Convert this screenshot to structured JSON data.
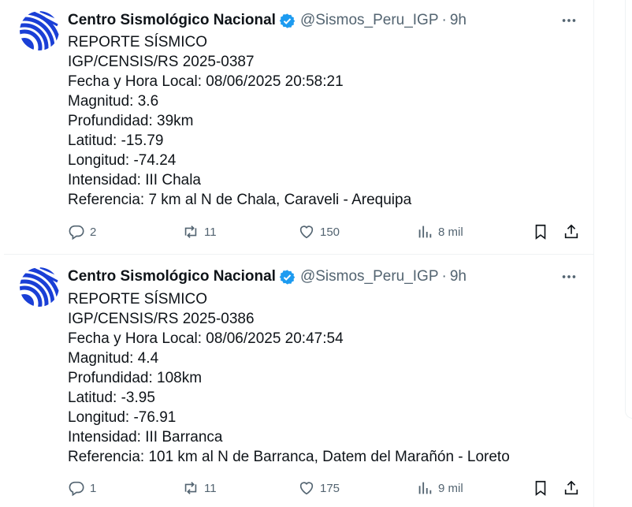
{
  "tweets": [
    {
      "author_name": "Centro Sismológico Nacional",
      "handle": "@Sismos_Peru_IGP",
      "separator": "·",
      "time": "9h",
      "lines": [
        "REPORTE SÍSMICO",
        "IGP/CENSIS/RS 2025-0387",
        "Fecha y Hora Local: 08/06/2025 20:58:21",
        "Magnitud: 3.6",
        "Profundidad: 39km",
        "Latitud: -15.79",
        "Longitud: -74.24",
        "Intensidad: III Chala",
        "Referencia: 7 km al N de Chala, Caraveli - Arequipa"
      ],
      "replies": "2",
      "reposts": "11",
      "likes": "150",
      "views": "8 mil"
    },
    {
      "author_name": "Centro Sismológico Nacional",
      "handle": "@Sismos_Peru_IGP",
      "separator": "·",
      "time": "9h",
      "lines": [
        "REPORTE SÍSMICO",
        "IGP/CENSIS/RS 2025-0386",
        "Fecha y Hora Local: 08/06/2025 20:47:54",
        "Magnitud: 4.4",
        "Profundidad: 108km",
        "Latitud: -3.95",
        "Longitud: -76.91",
        "Intensidad: III Barranca",
        "Referencia: 101 km al N de Barranca, Datem del Marañón - Loreto"
      ],
      "replies": "1",
      "reposts": "11",
      "likes": "175",
      "views": "9 mil"
    }
  ],
  "colors": {
    "text": "#0f1419",
    "secondary": "#536471",
    "verified": "#1d9bf0",
    "avatar_blue": "#1a3fd6",
    "divider": "#eff3f4"
  },
  "icons": [
    "verified-badge-icon",
    "more-icon",
    "reply-icon",
    "repost-icon",
    "like-icon",
    "views-icon",
    "bookmark-icon",
    "share-icon"
  ]
}
